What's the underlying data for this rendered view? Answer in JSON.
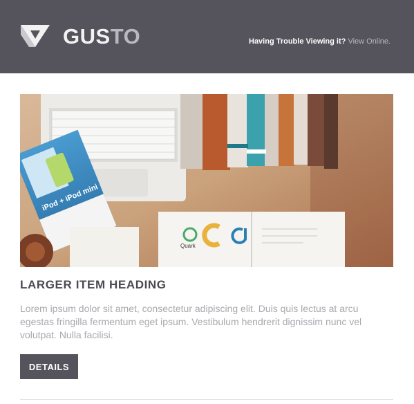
{
  "header": {
    "logo_text_a": "GUS",
    "logo_text_b": "TO",
    "trouble_text": "Having Trouble Viewing it? ",
    "view_online_link": "View Online."
  },
  "hero": {
    "image": "desk-flatlay-laptop-books-magazines-photo",
    "magazine_label": "iPod + iPod mini",
    "quark_label": "Quark"
  },
  "item": {
    "heading": "LARGER ITEM HEADING",
    "body": "Lorem ipsum dolor sit amet, consectetur adipiscing elit. Duis quis lectus at arcu egestas fringilla fermentum eget ipsum. Vestibulum hendrerit dignissim nunc vel volutpat. Nulla facilisi.",
    "button_label": "DETAILS"
  },
  "colors": {
    "header_bg": "#55545d",
    "button_bg": "#55545d",
    "heading": "#4b4a52",
    "body_text": "#a8a8ae"
  }
}
